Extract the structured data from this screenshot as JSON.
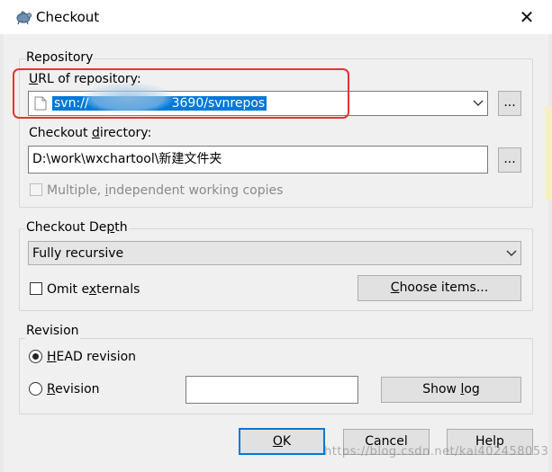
{
  "window": {
    "title": "Checkout",
    "close_label": "✕",
    "app_icon": "tortoise-svn-icon"
  },
  "repository": {
    "group_label": "Repository",
    "url_label_pre": "",
    "url_label_mnemonic": "U",
    "url_label_post": "RL of repository:",
    "url_value_start": "svn://",
    "url_value_end": "3690/svnrepos",
    "url_browse_label": "...",
    "dir_label_pre": "Checkout ",
    "dir_label_mnemonic": "d",
    "dir_label_post": "irectory:",
    "dir_value": "D:\\work\\wxchartool\\新建文件夹",
    "dir_browse_label": "...",
    "multiple_label_pre": "Multiple, ",
    "multiple_label_mnemonic": "i",
    "multiple_label_post": "ndependent working copies",
    "multiple_checked": false
  },
  "depth": {
    "group_label_pre": "Checkout De",
    "group_label_mnemonic": "p",
    "group_label_post": "th",
    "selected": "Fully recursive",
    "omit_label_pre": "Omit e",
    "omit_label_mnemonic": "x",
    "omit_label_post": "ternals",
    "omit_checked": false,
    "choose_items_pre": "",
    "choose_items_mnemonic": "C",
    "choose_items_post": "hoose items..."
  },
  "revision": {
    "group_label": "Revision",
    "head_pre": "",
    "head_mnemonic": "H",
    "head_post": "EAD revision",
    "head_selected": true,
    "rev_pre": "",
    "rev_mnemonic": "R",
    "rev_post": "evision",
    "rev_value": "",
    "show_log_pre": "Show ",
    "show_log_mnemonic": "l",
    "show_log_post": "og"
  },
  "buttons": {
    "ok_pre": "",
    "ok_mnemonic": "O",
    "ok_post": "K",
    "cancel": "Cancel",
    "help": "Help"
  },
  "overlay": {
    "watermark": "https://blog.csdn.net/kai402458053",
    "highlight_color": "#e8322f"
  }
}
